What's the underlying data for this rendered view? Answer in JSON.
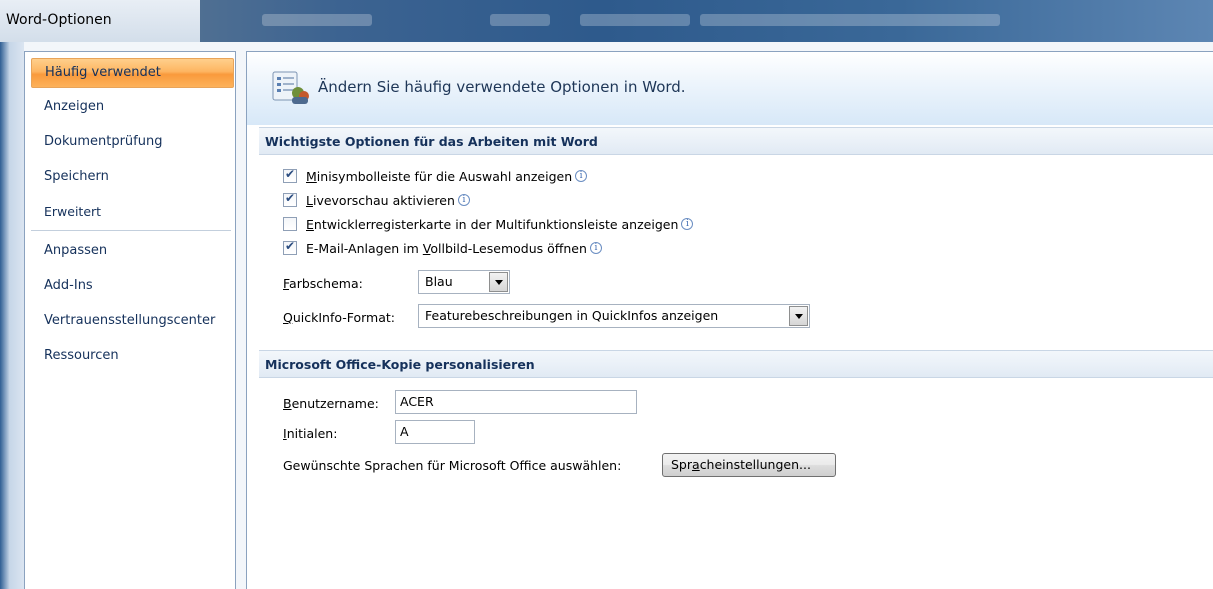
{
  "window": {
    "title": "Word-Optionen"
  },
  "nav": {
    "items": [
      {
        "label": "Häufig verwendet",
        "active": true
      },
      {
        "label": "Anzeigen"
      },
      {
        "label": "Dokumentprüfung"
      },
      {
        "label": "Speichern"
      },
      {
        "label": "Erweitert"
      },
      {
        "label": "Anpassen"
      },
      {
        "label": "Add-Ins"
      },
      {
        "label": "Vertrauensstellungscenter"
      },
      {
        "label": "Ressourcen"
      }
    ]
  },
  "banner": {
    "text": "Ändern Sie häufig verwendete Optionen in Word."
  },
  "section1": {
    "title": "Wichtigste Optionen für das Arbeiten mit Word",
    "checkboxes": [
      {
        "key": "M",
        "rest": "inisymbolleiste für die Auswahl anzeigen",
        "checked": true
      },
      {
        "key": "L",
        "rest": "ivevorschau aktivieren",
        "checked": true
      },
      {
        "key": "E",
        "rest": "ntwicklerregisterkarte in der Multifunktionsleiste anzeigen",
        "checked": false
      },
      {
        "pre": "E-Mail-Anlagen im ",
        "key": "V",
        "rest": "ollbild-Lesemodus öffnen",
        "checked": true
      }
    ],
    "color_scheme": {
      "key": "F",
      "rest": "arbschema:",
      "value": "Blau"
    },
    "tooltip_format": {
      "key": "Q",
      "rest": "uickInfo-Format:",
      "value": "Featurebeschreibungen in QuickInfos anzeigen"
    }
  },
  "section2": {
    "title": "Microsoft Office-Kopie personalisieren",
    "username": {
      "key": "B",
      "rest": "enutzername:",
      "value": "ACER"
    },
    "initials": {
      "key": "I",
      "rest": "nitialen:",
      "value": "A"
    },
    "language": {
      "label": "Gewünschte Sprachen für Microsoft Office auswählen:",
      "button_pre": "Spr",
      "button_key": "a",
      "button_rest": "cheinstellungen..."
    }
  },
  "icons": {
    "info": "info-icon",
    "banner": "options-settings-icon",
    "dropdown": "chevron-down-icon"
  }
}
